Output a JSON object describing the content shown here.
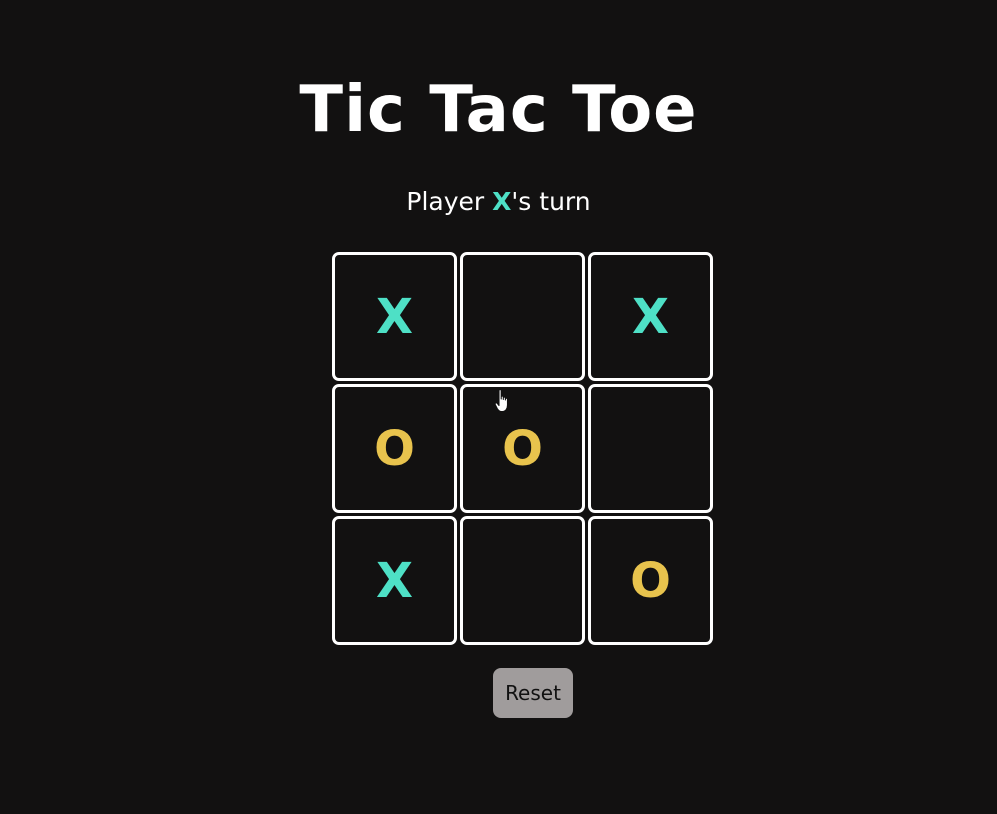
{
  "title": "Tic Tac Toe",
  "status": {
    "prefix": "Player ",
    "player": "X",
    "suffix": "'s turn"
  },
  "board": {
    "cells": [
      "X",
      "",
      "X",
      "O",
      "O",
      "",
      "X",
      "",
      "O"
    ]
  },
  "reset_label": "Reset",
  "colors": {
    "background": "#121111",
    "x_mark": "#4ee0c6",
    "o_mark": "#e8c34d",
    "cell_border": "#ffffff",
    "reset_button": "#a09c9c"
  },
  "cursor": "hand-pointer-icon"
}
